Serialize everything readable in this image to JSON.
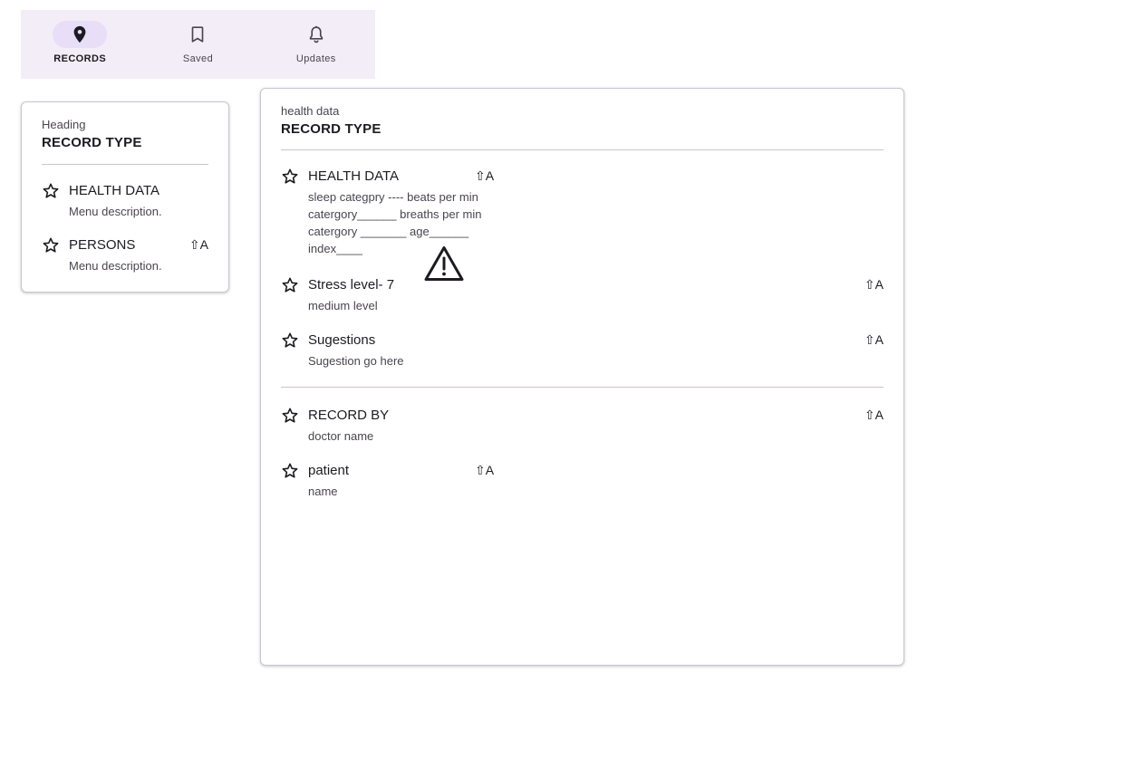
{
  "nav": {
    "items": [
      {
        "label": "RECORDS",
        "icon": "location-pin-icon",
        "active": true
      },
      {
        "label": "Saved",
        "icon": "bookmark-icon",
        "active": false
      },
      {
        "label": "Updates",
        "icon": "bell-icon",
        "active": false
      }
    ]
  },
  "side_menu": {
    "overline": "Heading",
    "title": "RECORD TYPE",
    "items": [
      {
        "label": "HEALTH DATA",
        "description": "Menu description.",
        "icon": "star-icon",
        "shortcut": ""
      },
      {
        "label": "PERSONS",
        "description": "Menu description.",
        "icon": "star-icon",
        "shortcut": "⇧A"
      }
    ]
  },
  "main_menu": {
    "overline": "health data",
    "title": "RECORD TYPE",
    "items": [
      {
        "label": "HEALTH DATA",
        "description": "sleep categpry ---- beats per min catergory______ breaths per min catergory _______ age______ index____",
        "icon": "star-icon",
        "shortcut": "⇧A"
      },
      {
        "label": "Stress level- 7",
        "description": "medium level",
        "icon": "star-icon",
        "shortcut": "⇧A"
      },
      {
        "label": "Sugestions",
        "description": "Sugestion go here",
        "icon": "star-icon",
        "shortcut": "⇧A"
      },
      {
        "label": "RECORD BY",
        "description": "doctor name",
        "icon": "star-icon",
        "shortcut": "⇧A"
      },
      {
        "label": "patient",
        "description": "name",
        "icon": "star-icon",
        "shortcut": "⇧A"
      }
    ],
    "warning_icon": "warning-triangle-icon"
  },
  "colors": {
    "nav_background": "#f3edf7",
    "nav_active_indicator": "#e8def8",
    "text_primary": "#1d1b20",
    "text_secondary": "#49454f",
    "divider": "#cac4d0"
  }
}
